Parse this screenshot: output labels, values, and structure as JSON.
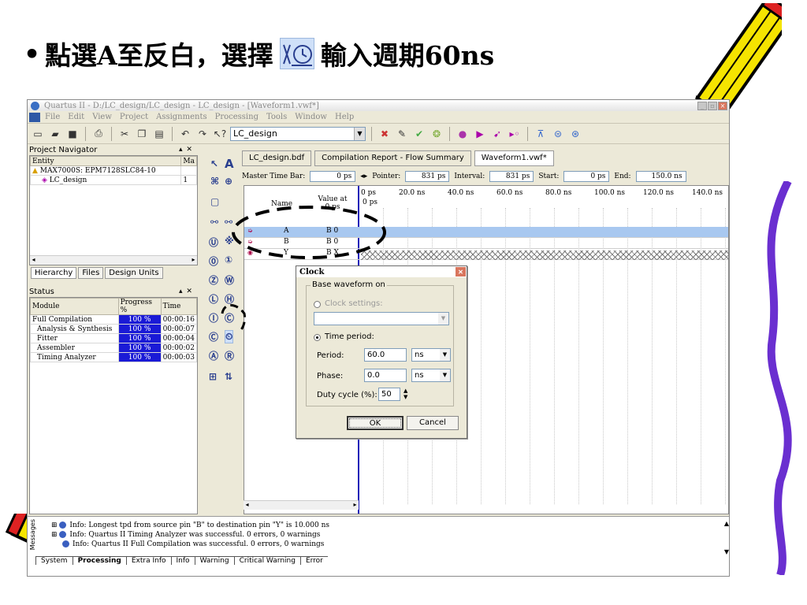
{
  "slide": {
    "title_before": "點選A至反白，選擇",
    "title_after": "輸入週期60ns",
    "bullet": "•",
    "title_icon": "clock-waveform-icon"
  },
  "window": {
    "title": "Quartus II - D:/LC_design/LC_design - LC_design - [Waveform1.vwf*]",
    "menu": [
      "File",
      "Edit",
      "View",
      "Project",
      "Assignments",
      "Processing",
      "Tools",
      "Window",
      "Help"
    ],
    "project_combo": "LC_design"
  },
  "navigator": {
    "header": "Project Navigator",
    "col_entity": "Entity",
    "col_macro": "Ma",
    "device": "MAX7000S: EPM7128SLC84-10",
    "entity": "LC_design",
    "entity_count": "1",
    "tabs": [
      "Hierarchy",
      "Files",
      "Design Units"
    ]
  },
  "status": {
    "header": "Status",
    "columns": [
      "Module",
      "Progress %",
      "Time"
    ],
    "rows": [
      {
        "module": "Full Compilation",
        "progress": "100 %",
        "time": "00:00:16"
      },
      {
        "module": "Analysis & Synthesis",
        "progress": "100 %",
        "time": "00:00:07"
      },
      {
        "module": "Fitter",
        "progress": "100 %",
        "time": "00:00:04"
      },
      {
        "module": "Assembler",
        "progress": "100 %",
        "time": "00:00:02"
      },
      {
        "module": "Timing Analyzer",
        "progress": "100 %",
        "time": "00:00:03"
      }
    ]
  },
  "doc_tabs": [
    "LC_design.bdf",
    "Compilation Report - Flow Summary",
    "Waveform1.vwf*"
  ],
  "infobar": {
    "master_label": "Master Time Bar:",
    "master_value": "0 ps",
    "pointer_label": "Pointer:",
    "pointer_value": "831 ps",
    "interval_label": "Interval:",
    "interval_value": "831 ps",
    "start_label": "Start:",
    "start_value": "0 ps",
    "end_label": "End:",
    "end_value": "150.0 ns"
  },
  "waveform": {
    "col_name": "Name",
    "col_value": "Value at 0 ps",
    "ruler_origin": "0 ps",
    "ruler": [
      "0 ps",
      "20.0 ns",
      "40.0 ns",
      "60.0 ns",
      "80.0 ns",
      "100.0 ns",
      "120.0 ns",
      "140.0 ns"
    ],
    "signals": [
      {
        "name": "A",
        "value": "B 0"
      },
      {
        "name": "B",
        "value": "B 0"
      },
      {
        "name": "Y",
        "value": "B X"
      }
    ]
  },
  "dialog": {
    "title": "Clock",
    "group": "Base waveform on",
    "clock_settings": "Clock settings:",
    "time_period": "Time period:",
    "period_label": "Period:",
    "period_value": "60.0",
    "period_unit": "ns",
    "phase_label": "Phase:",
    "phase_value": "0.0",
    "phase_unit": "ns",
    "duty_label": "Duty cycle (%):",
    "duty_value": "50",
    "ok": "OK",
    "cancel": "Cancel"
  },
  "messages": {
    "lines": [
      "Info: Longest tpd from source pin \"B\" to destination pin \"Y\" is 10.000 ns",
      "Info: Quartus II Timing Analyzer was successful. 0 errors, 0 warnings",
      "Info: Quartus II Full Compilation was successful. 0 errors, 0 warnings"
    ],
    "tabs": [
      "System",
      "Processing",
      "Extra Info",
      "Info",
      "Warning",
      "Critical Warning",
      "Error"
    ],
    "side_label": "Messages"
  },
  "colors": {
    "accent_blue": "#1a1ad6",
    "selection": "#a8c8f0",
    "cursor_line": "#1c1cb8",
    "purple_decor": "#6a2fd0"
  }
}
